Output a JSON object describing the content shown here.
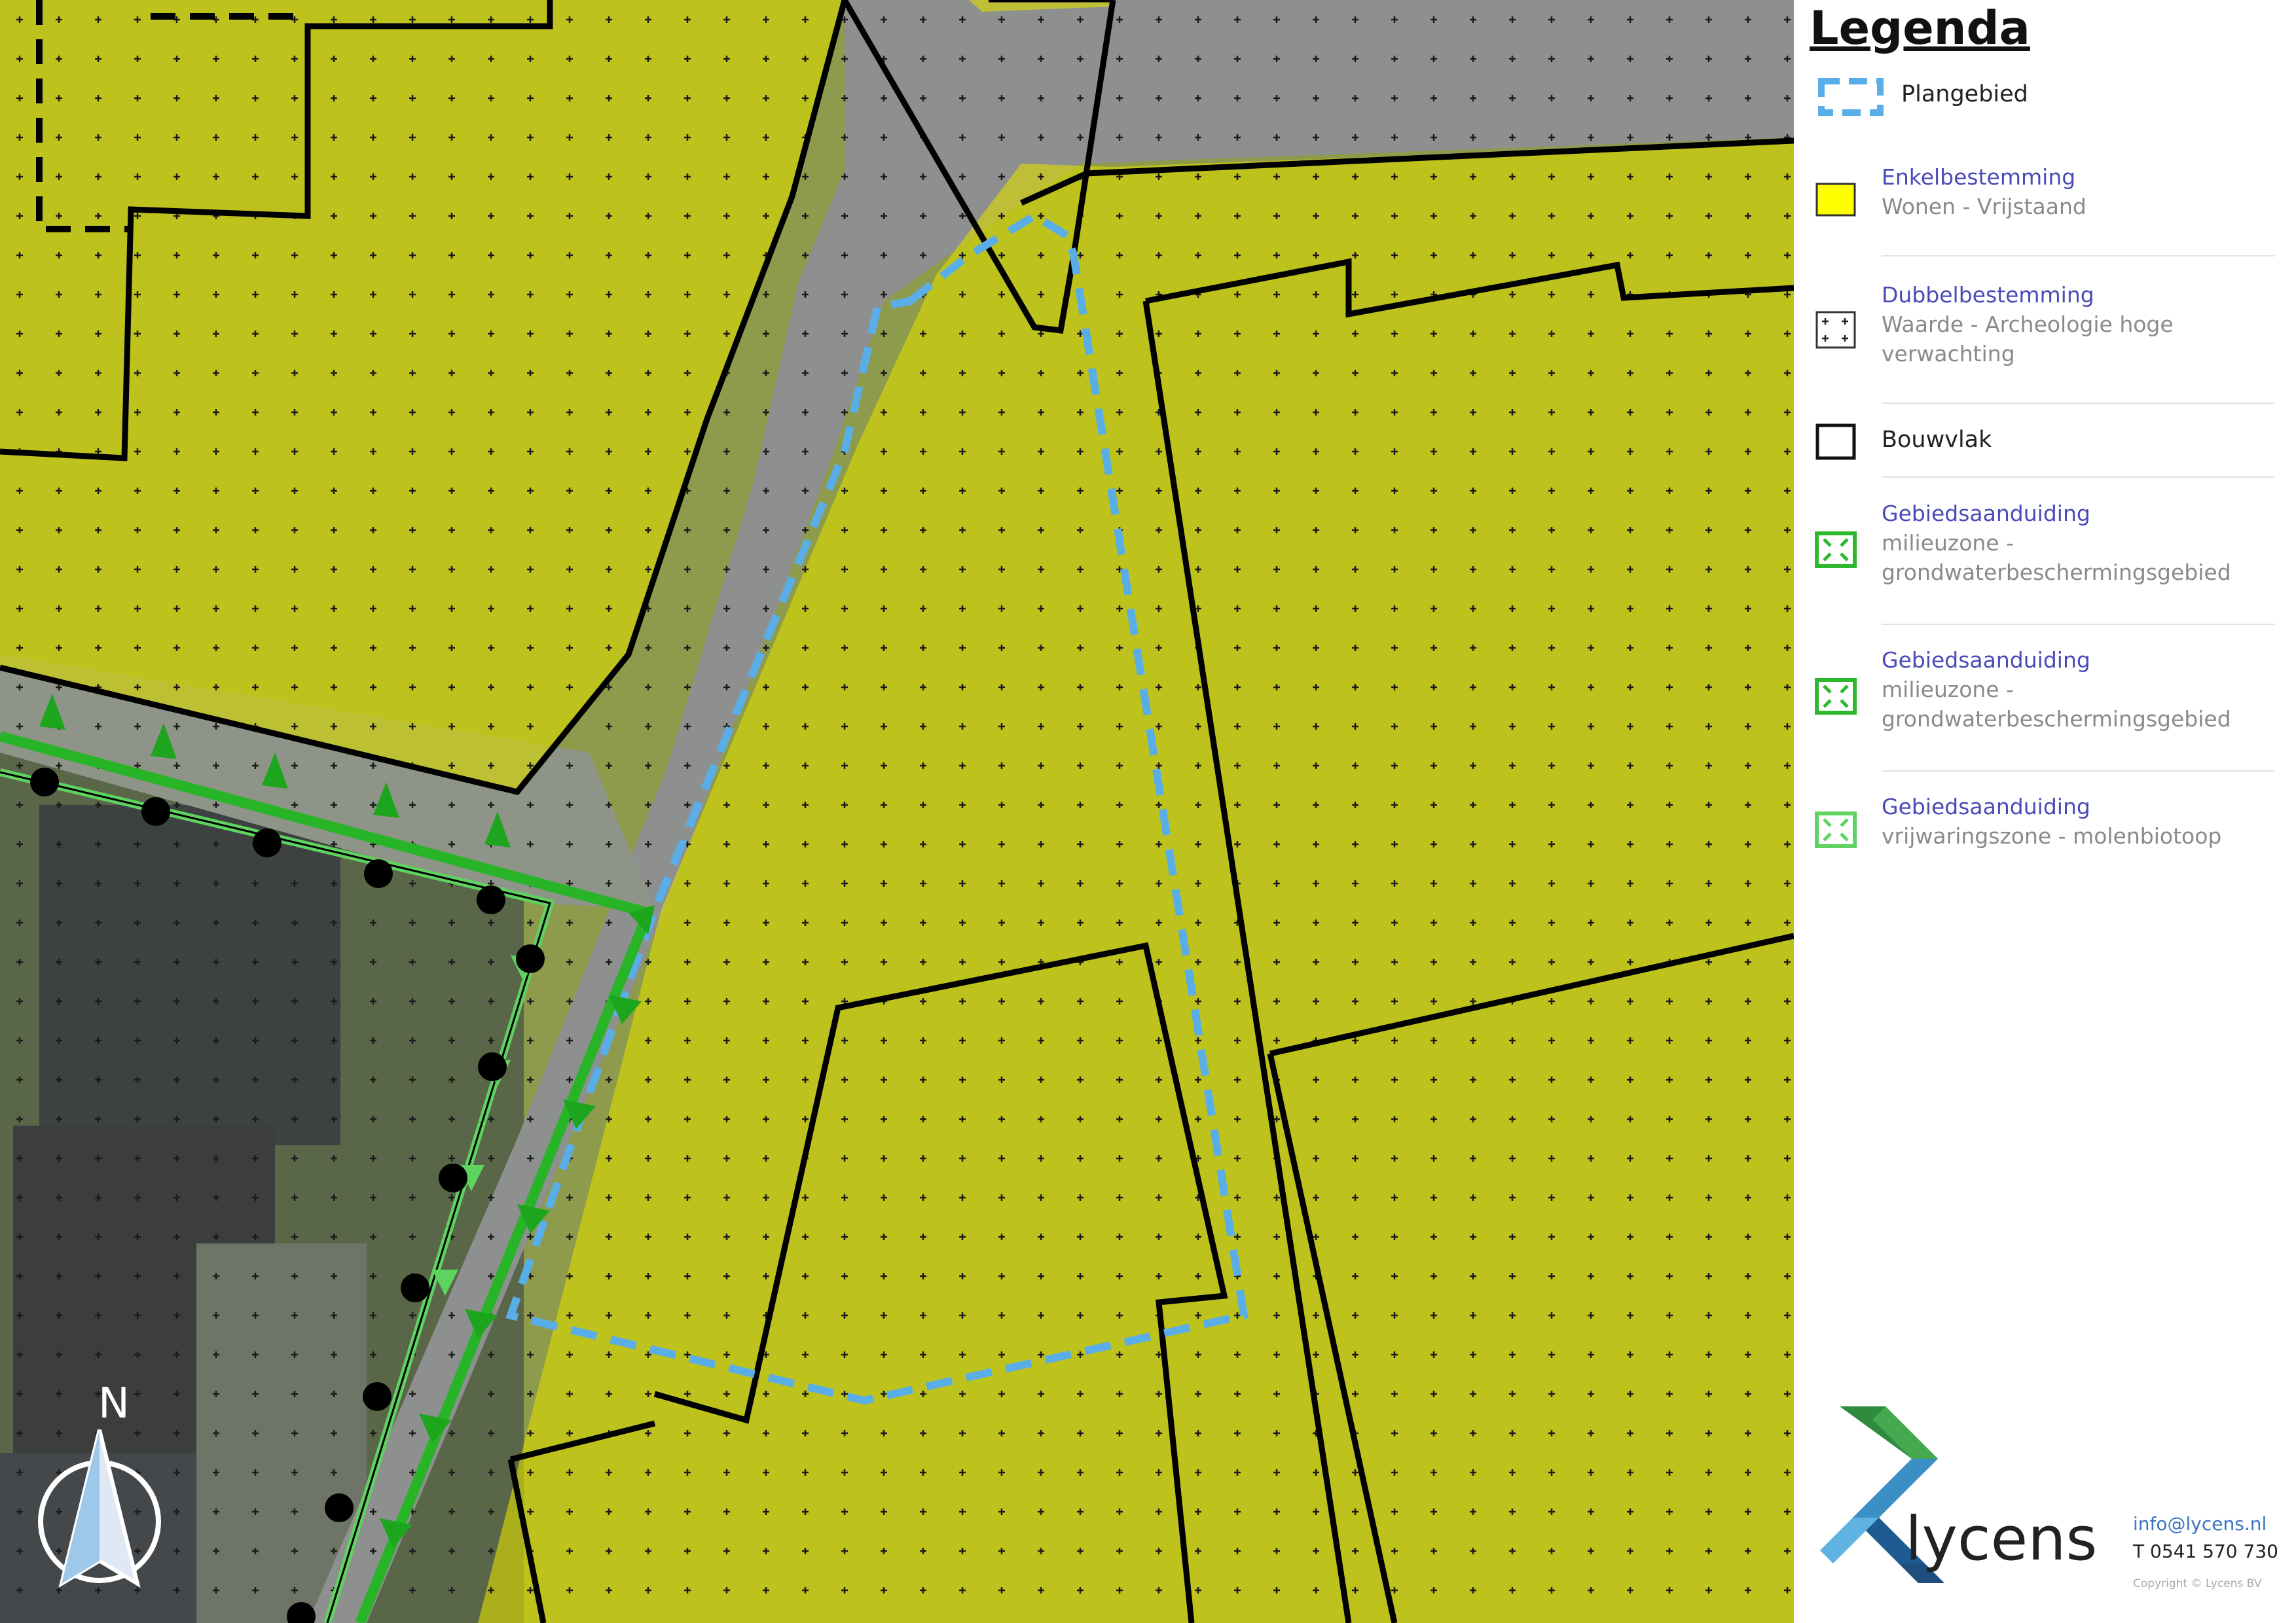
{
  "legend": {
    "title": "Legenda",
    "items": [
      {
        "label": "Plangebied"
      },
      {
        "category": "Enkelbestemming",
        "value": "Wonen - Vrijstaand",
        "color": "#ffff00"
      },
      {
        "category": "Dubbelbestemming",
        "value": "Waarde - Archeologie hoge\nverwachting"
      },
      {
        "label": "Bouwvlak"
      },
      {
        "category": "Gebiedsaanduiding",
        "value": "milieuzone -\ngrondwaterbeschermingsgebied",
        "color": "#2db82d"
      },
      {
        "category": "Gebiedsaanduiding",
        "value": "milieuzone -\ngrondwaterbeschermingsgebied",
        "color": "#2db82d"
      },
      {
        "category": "Gebiedsaanduiding",
        "value": "vrijwaringszone - molenbiotoop",
        "color": "#5fd35f"
      }
    ]
  },
  "company": {
    "name": "lycens",
    "email": "info@lycens.nl",
    "phone": "T 0541 570 730",
    "copyright": "Copyright © Lycens BV"
  },
  "map": {
    "north_label": "N",
    "zone_color": "#d7d600",
    "plan_boundary_color": "#5aaee8",
    "line_color": "#000000",
    "molen_line_color": "#27b427"
  }
}
